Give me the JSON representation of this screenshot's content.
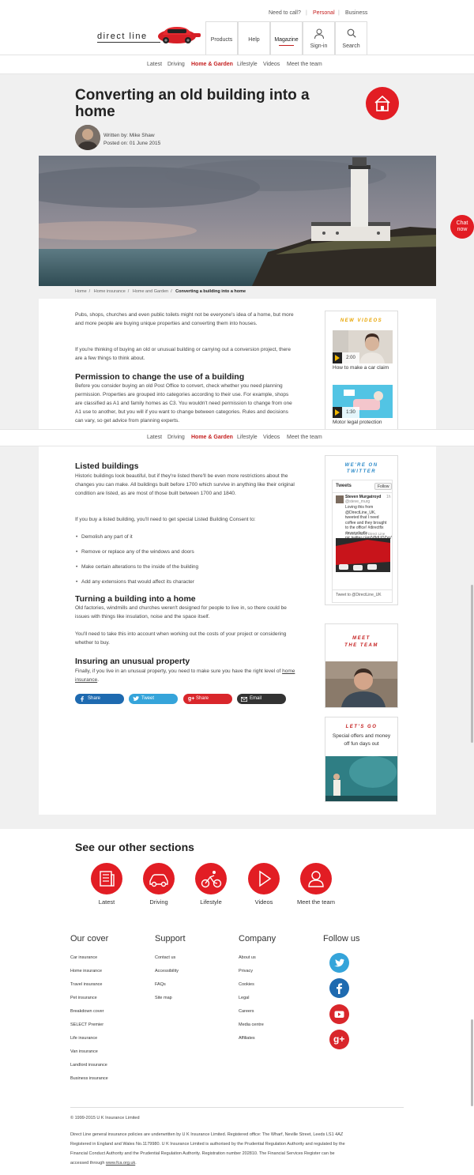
{
  "header": {
    "utility": [
      "Need to call?",
      "Personal",
      "Business"
    ],
    "logo_text": "direct line",
    "nav": [
      {
        "label": "Products"
      },
      {
        "label": "Help"
      },
      {
        "label": "Magazine"
      },
      {
        "label": "Sign-in"
      },
      {
        "label": "Search"
      }
    ]
  },
  "subnav": [
    "Latest",
    "Driving",
    "Home & Garden",
    "Lifestyle",
    "Videos",
    "Meet the team"
  ],
  "article": {
    "title": "Converting an old building into a home",
    "byline_author": "Written by: Mike Shaw",
    "byline_date": "Posted on: 01 June 2015",
    "breadcrumb": [
      "Home",
      "Home insurance",
      "Home and Garden",
      "Converting a building into a home"
    ],
    "intro_1": "Pubs, shops, churches and even public toilets might not be everyone's idea of a home, but more and more people are buying unique properties and converting them into houses.",
    "intro_2": "If you're thinking of buying an old or unusual building or carrying out a conversion project, there are a few things to think about.",
    "h_permission": "Permission to change the use of a building",
    "p_permission": "Before you consider buying an old Post Office to convert, check whether you need planning permission. Properties are grouped into categories according to their use. For example, shops are classified as A1 and family homes as C3. You wouldn't need permission to change from one A1 use to another, but you will if you want to change between categories. Rules and decisions can vary, so get advice from planning experts.",
    "h_listed": "Listed buildings",
    "p_listed": "Historic buildings look beautiful, but if they're listed there'll be even more restrictions about the changes you can make. All buildings built before 1700 which survive in anything like their original condition are listed, as are most of those built between 1700 and 1840.",
    "p_listed2": "If you buy a listed building, you'll need to get special Listed Building Consent to:",
    "bullets": [
      "Demolish any part of it",
      "Remove or replace any of the windows and doors",
      "Make certain alterations to the inside of the building",
      "Add any extensions that would affect its character"
    ],
    "h_turning": "Turning a building into a home",
    "p_turning": "Old factories, windmills and churches weren't designed for people to live in, so there could be issues with things like insulation, noise and the space itself.",
    "p_turning2": "You'll need to take this into account when working out the costs of your project or considering whether to buy.",
    "h_insuring": "Insuring an unusual property",
    "p_insuring": "Finally, if you live in an unusual property, you need to make sure you have the right level of",
    "p_insuring_link": "home insurance",
    "share": [
      "Share",
      "Tweet",
      "Share",
      "Email"
    ]
  },
  "sidebar": {
    "videos_title": "NEW VIDEOS",
    "video1_time": "2:00",
    "video1_caption": "How to make a car claim",
    "video2_time": "1:30",
    "video2_caption": "Motor legal protection",
    "twitter_title_1": "WE'RE ON",
    "twitter_title_2": "TWITTER",
    "tweets_label": "Tweets",
    "follow_label": "Follow",
    "tweet_user": "Steven Murgatroyd",
    "tweet_handle": "@steve_murg",
    "tweet_time": "1h",
    "tweet_text": "Loving this from @DirectLine_UK, tweeted that I need coffee and they brought to the office! #directfix #everydayfix pic.twitter.com/V8dUOZxnYk",
    "retweet_label": "Retweeted by Direct Line",
    "tweet_to": "Tweet to @DirectLine_UK",
    "meet_title_1": "MEET",
    "meet_title_2": "THE TEAM",
    "letsgo_title": "LET'S GO",
    "letsgo_text": "Special offers and money off fun days out"
  },
  "chat_label_1": "Chat",
  "chat_label_2": "now",
  "sections": {
    "title": "See our other sections",
    "items": [
      "Latest",
      "Driving",
      "Lifestyle",
      "Videos",
      "Meet the team"
    ]
  },
  "footer": {
    "cover_title": "Our cover",
    "cover_links": [
      "Car insurance",
      "Home insurance",
      "Travel insurance",
      "Pet insurance",
      "Breakdown cover",
      "SELECT Premier",
      "Life insurance",
      "Van insurance",
      "Landlord insurance",
      "Business insurance"
    ],
    "support_title": "Support",
    "support_links": [
      "Contact us",
      "Accessibility",
      "FAQs",
      "Site map"
    ],
    "company_title": "Company",
    "company_links": [
      "About us",
      "Privacy",
      "Cookies",
      "Legal",
      "Careers",
      "Media centre",
      "Affiliates"
    ],
    "follow_title": "Follow us",
    "copyright": "© 1999-2015 U K Insurance Limited",
    "legal_1": "Direct Line general insurance policies are underwritten by U K Insurance Limited. Registered office: The Wharf, Neville Street, Leeds LS1 4AZ",
    "legal_2": "Registered in England and Wales No.1179980. U K Insurance Limited is authorised by the Prudential Regulation Authority and regulated by the",
    "legal_3": "Financial Conduct Authority and the Prudential Regulation Authority. Registration number 202810. The Financial Services Register can be",
    "legal_4": "accessed through",
    "legal_link": "www.fca.org.uk",
    "legal_4_end": "."
  },
  "colors": {
    "brand_red": "#e21d24",
    "facebook": "#1e6ab0",
    "twitter": "#35a4da",
    "googleplus": "#d9262b",
    "email": "#333333"
  }
}
